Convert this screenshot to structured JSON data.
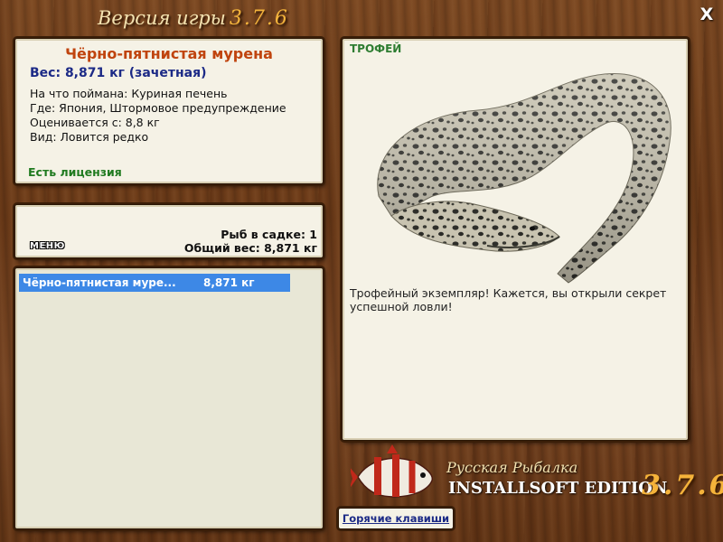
{
  "header": {
    "title": "Версия игры",
    "version": "3.7.6",
    "close_label": "X"
  },
  "fish_info": {
    "name": "Чёрно-пятнистая мурена",
    "weight": "Вес: 8,871 кг (зачетная)",
    "bait": "На что поймана: Куриная печень",
    "location": "Где: Япония, Штормовое предупреждение",
    "min_weight": "Оценивается с: 8,8 кг",
    "rarity": "Вид: Ловится редко",
    "license": "Есть лицензия"
  },
  "summary": {
    "menu_label": "МЕНЮ",
    "fish_count": "Рыб в садке: 1",
    "total_weight": "Общий вес: 8,871 кг"
  },
  "catch_list": [
    {
      "name": "Чёрно-пятнистая муре...",
      "weight": "8,871 кг"
    }
  ],
  "trophy": {
    "label": "ТРОФЕЙ",
    "description": "Трофейный экземпляр! Кажется, вы открыли секрет успешной ловли!"
  },
  "brand": {
    "subtitle": "Русская Рыбалка",
    "edition": "INSTALLSOFT EDITION",
    "version": "3.7.6"
  },
  "hotkeys_label": "Горячие клавиши",
  "colors": {
    "wood": "#6b3d1c",
    "panel": "#f5f2e6",
    "title_orange": "#c0440e",
    "weight_blue": "#1c2a86",
    "license_green": "#1f7a1f",
    "selection_blue": "#3d88e6",
    "version_gold": "#f4b43c"
  }
}
